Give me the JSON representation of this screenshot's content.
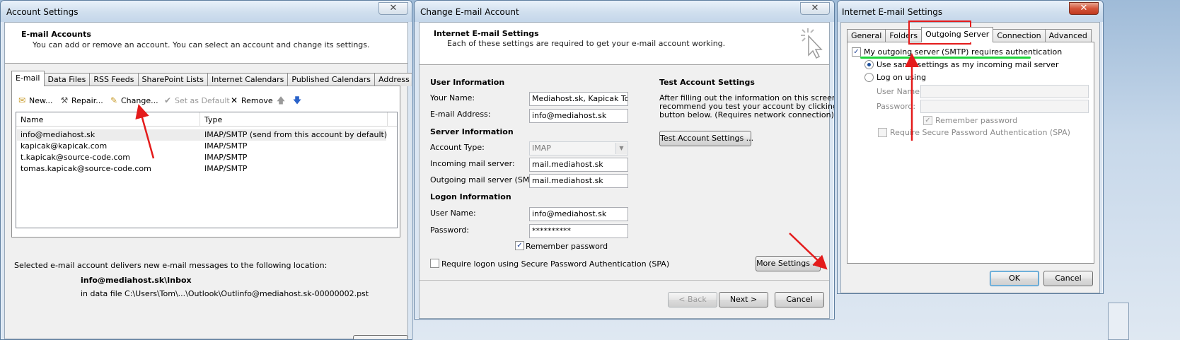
{
  "account_settings": {
    "title": "Account Settings",
    "close": "✕",
    "header_title": "E-mail Accounts",
    "header_sub": "You can add or remove an account. You can select an account and change its settings.",
    "tabs": [
      "E-mail",
      "Data Files",
      "RSS Feeds",
      "SharePoint Lists",
      "Internet Calendars",
      "Published Calendars",
      "Address Books"
    ],
    "toolbar": {
      "new": "New...",
      "repair": "Repair...",
      "change": "Change...",
      "set_default": "Set as Default",
      "remove": "Remove"
    },
    "columns": [
      "Name",
      "Type"
    ],
    "rows": [
      {
        "name": "info@mediahost.sk",
        "type": "IMAP/SMTP (send from this account by default)"
      },
      {
        "name": "kapicak@kapicak.com",
        "type": "IMAP/SMTP"
      },
      {
        "name": "t.kapicak@source-code.com",
        "type": "IMAP/SMTP"
      },
      {
        "name": "tomas.kapicak@source-code.com",
        "type": "IMAP/SMTP"
      }
    ],
    "delivery_label": "Selected e-mail account delivers new e-mail messages to the following location:",
    "delivery_folder": "info@mediahost.sk\\Inbox",
    "delivery_file": "in data file C:\\Users\\Tom\\...\\Outlook\\Outlinfo@mediahost.sk-00000002.pst"
  },
  "change_account": {
    "title": "Change E-mail Account",
    "close": "✕",
    "header_title": "Internet E-mail Settings",
    "header_sub": "Each of these settings are required to get your e-mail account working.",
    "user_info_heading": "User Information",
    "your_name_label": "Your Name:",
    "your_name_value": "Mediahost.sk, Kapicak Tomas",
    "email_label": "E-mail Address:",
    "email_value": "info@mediahost.sk",
    "server_info_heading": "Server Information",
    "account_type_label": "Account Type:",
    "account_type_value": "IMAP",
    "incoming_label": "Incoming mail server:",
    "incoming_value": "mail.mediahost.sk",
    "outgoing_label": "Outgoing mail server (SMTP):",
    "outgoing_value": "mail.mediahost.sk",
    "logon_heading": "Logon Information",
    "username_label": "User Name:",
    "username_value": "info@mediahost.sk",
    "password_label": "Password:",
    "password_value": "**********",
    "remember_password": "Remember password",
    "require_spa": "Require logon using Secure Password Authentication (SPA)",
    "test_heading": "Test Account Settings",
    "test_desc_1": "After filling out the information on this screen, we",
    "test_desc_2": "recommend you test your account by clicking the",
    "test_desc_3": "button below. (Requires network connection)",
    "test_button": "Test Account Settings ...",
    "more_settings": "More Settings ...",
    "back": "< Back",
    "next": "Next >",
    "cancel": "Cancel"
  },
  "internet_settings": {
    "title": "Internet E-mail Settings",
    "close": "✕",
    "tabs": [
      "General",
      "Folders",
      "Outgoing Server",
      "Connection",
      "Advanced"
    ],
    "smtp_auth": "My outgoing server (SMTP) requires authentication",
    "use_same": "Use same settings as my incoming mail server",
    "logon_using": "Log on using",
    "username_label": "User Name:",
    "password_label": "Password:",
    "remember_password": "Remember password",
    "require_spa": "Require Secure Password Authentication (SPA)",
    "ok": "OK",
    "cancel": "Cancel"
  },
  "colors": {
    "annotation_red": "#e41b1b",
    "annotation_green": "#1ed33a"
  }
}
